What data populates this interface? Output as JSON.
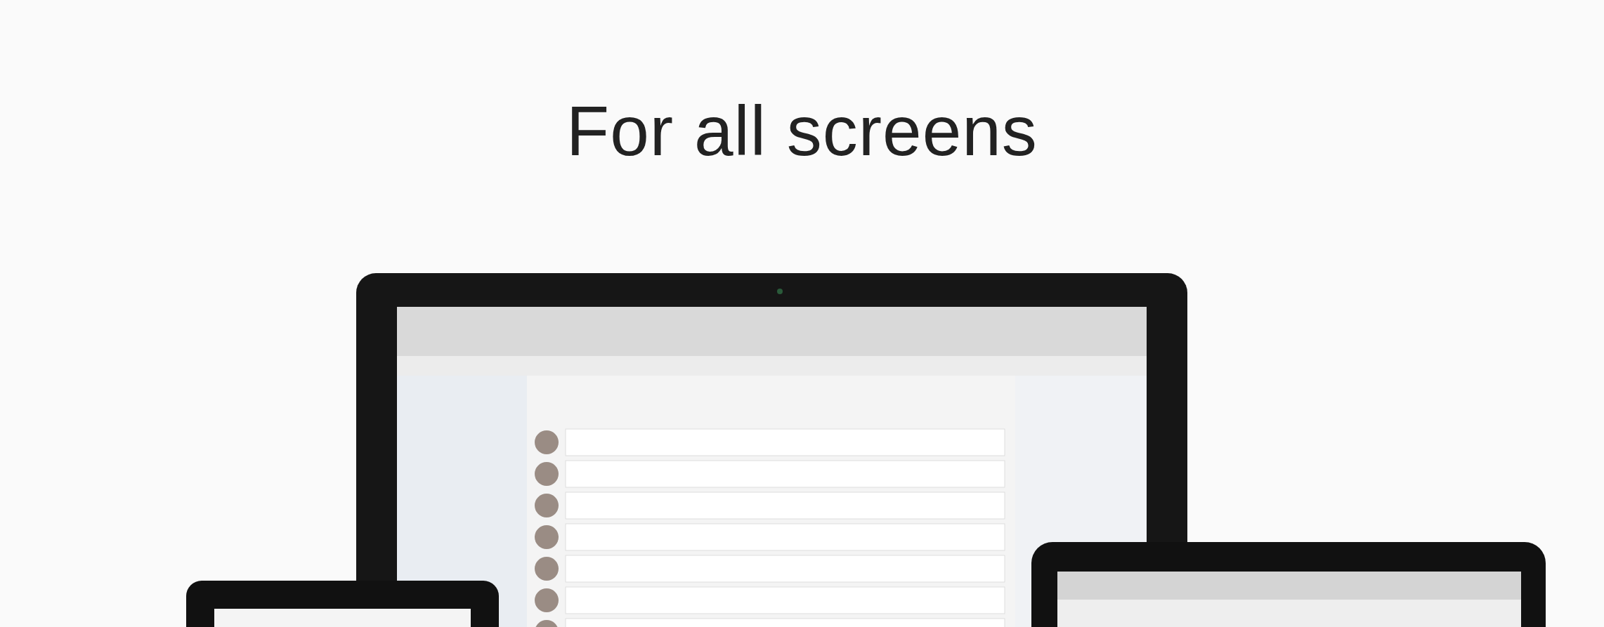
{
  "heading": "For all screens"
}
